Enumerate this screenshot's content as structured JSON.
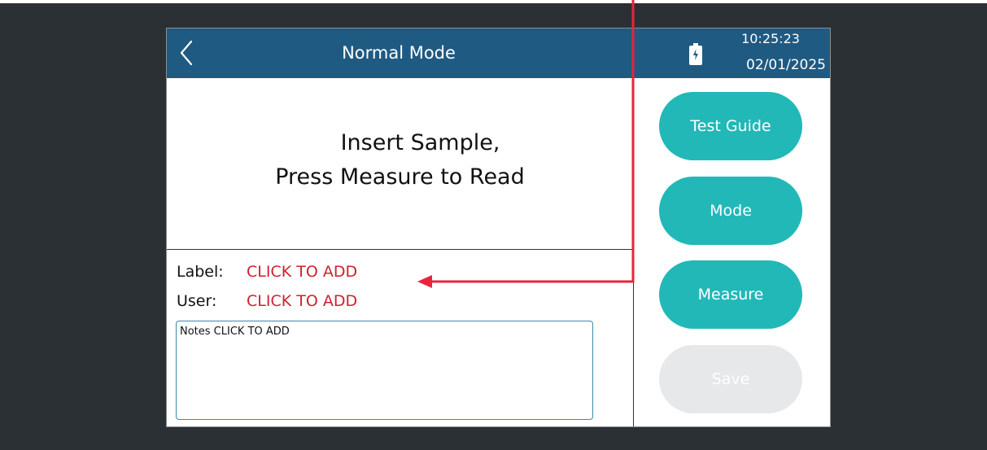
{
  "header": {
    "title": "Normal Mode",
    "back_icon": "chevron-left-icon",
    "battery_icon": "battery-charging-icon",
    "time": "10:25:23",
    "date": "02/01/2025"
  },
  "main": {
    "prompt_line1": "Insert Sample,",
    "prompt_line2": "Press Measure to Read"
  },
  "fields": {
    "label_label": "Label:",
    "label_value": "CLICK TO ADD",
    "user_label": "User:",
    "user_value": "CLICK TO ADD",
    "notes_text": "Notes CLICK TO ADD"
  },
  "buttons": {
    "test_guide": "Test Guide",
    "mode": "Mode",
    "measure": "Measure",
    "save": "Save",
    "save_enabled": false
  },
  "colors": {
    "header_bg": "#1f5a82",
    "button_teal": "#22b8b8",
    "button_disabled": "#e6e8e9",
    "click_to_add_red": "#d0202f",
    "annotation_arrow": "#e8243c",
    "backdrop": "#2b3034"
  }
}
